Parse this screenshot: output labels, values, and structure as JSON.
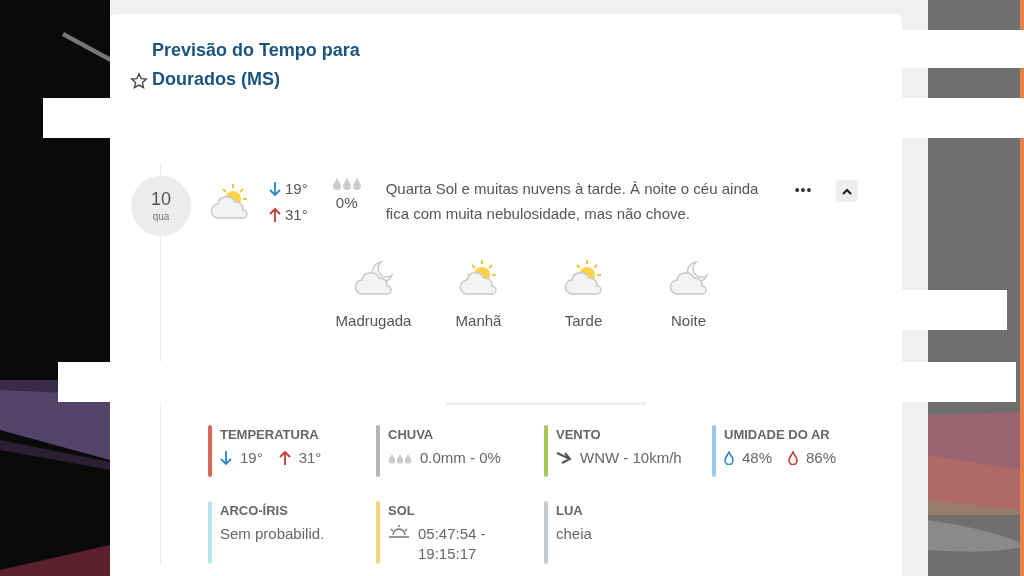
{
  "header": {
    "title": "Previsão do Tempo para Dourados (MS)"
  },
  "day": {
    "number": "10",
    "weekday": "qua",
    "low": "19°",
    "high": "31°",
    "rain_chance": "0%",
    "description": "Quarta Sol e muitas nuvens à tarde. À noite o céu ainda fica com muita nebulosidade, mas não chove.",
    "more": "•••",
    "expanded": true
  },
  "periods": [
    {
      "label": "Madrugada",
      "kind": "moon"
    },
    {
      "label": "Manhã",
      "kind": "sun"
    },
    {
      "label": "Tarde",
      "kind": "sun"
    },
    {
      "label": "Noite",
      "kind": "moon"
    }
  ],
  "details": [
    {
      "label": "TEMPERATURA",
      "color": "#d9685f",
      "kind": "temperature",
      "values": [
        "19°",
        "31°"
      ]
    },
    {
      "label": "CHUVA",
      "color": "#b5b5b5",
      "kind": "rain",
      "values": [
        "0.0mm - 0%"
      ]
    },
    {
      "label": "VENTO",
      "color": "#a8c95a",
      "kind": "wind",
      "values": [
        "WNW - 10km/h"
      ]
    },
    {
      "label": "UMIDADE DO AR",
      "color": "#9cc8ee",
      "kind": "humidity",
      "values": [
        "48%",
        "86%"
      ]
    },
    {
      "label": "ARCO-ÍRIS",
      "color": "#b7e6ec",
      "kind": "plain",
      "values": [
        "Sem probabilid."
      ]
    },
    {
      "label": "SOL",
      "color": "#f2d77a",
      "kind": "sun",
      "values": [
        "05:47:54 - 19:15:17"
      ]
    },
    {
      "label": "LUA",
      "color": "#c5cbd0",
      "kind": "plain",
      "values": [
        "cheia"
      ]
    }
  ]
}
